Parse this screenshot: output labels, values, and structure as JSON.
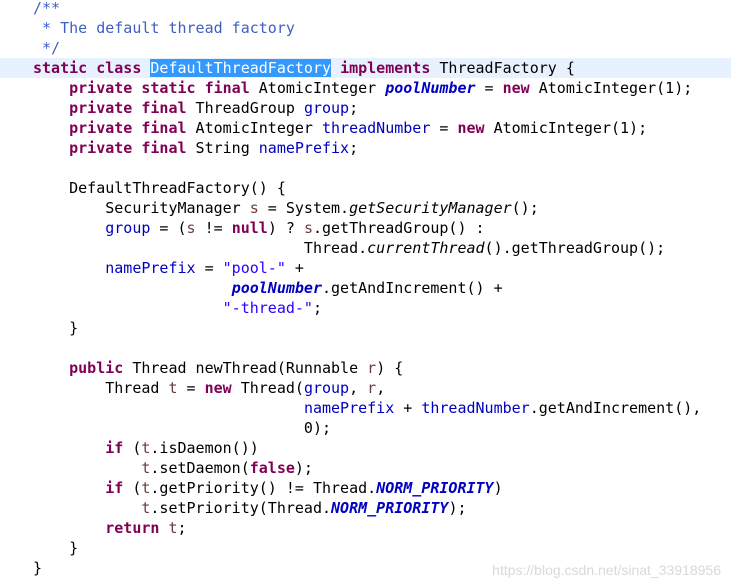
{
  "editor": {
    "language": "java",
    "current_line_highlight": "#e8f2fe",
    "selection_color": "#3399ff",
    "colors": {
      "keyword": "#7f0055",
      "field": "#0000c0",
      "string": "#2a00ff",
      "comment": "#3f5fbf",
      "local_variable": "#6a3e3e"
    },
    "lines": [
      [
        [
          "cmt",
          "/**"
        ]
      ],
      [
        [
          "cmt",
          " * The default thread factory"
        ]
      ],
      [
        [
          "cmt",
          " */"
        ]
      ],
      [
        [
          "kw",
          "static"
        ],
        [
          "plain",
          " "
        ],
        [
          "kw",
          "class"
        ],
        [
          "plain",
          " "
        ],
        [
          "sel",
          "DefaultThreadFactory"
        ],
        [
          "plain",
          " "
        ],
        [
          "kw",
          "implements"
        ],
        [
          "plain",
          " ThreadFactory {"
        ]
      ],
      [
        [
          "plain",
          "    "
        ],
        [
          "kw",
          "private"
        ],
        [
          "plain",
          " "
        ],
        [
          "kw",
          "static"
        ],
        [
          "plain",
          " "
        ],
        [
          "kw",
          "final"
        ],
        [
          "plain",
          " AtomicInteger "
        ],
        [
          "sfield",
          "poolNumber"
        ],
        [
          "plain",
          " = "
        ],
        [
          "kw",
          "new"
        ],
        [
          "plain",
          " AtomicInteger(1);"
        ]
      ],
      [
        [
          "plain",
          "    "
        ],
        [
          "kw",
          "private"
        ],
        [
          "plain",
          " "
        ],
        [
          "kw",
          "final"
        ],
        [
          "plain",
          " ThreadGroup "
        ],
        [
          "field",
          "group"
        ],
        [
          "plain",
          ";"
        ]
      ],
      [
        [
          "plain",
          "    "
        ],
        [
          "kw",
          "private"
        ],
        [
          "plain",
          " "
        ],
        [
          "kw",
          "final"
        ],
        [
          "plain",
          " AtomicInteger "
        ],
        [
          "field",
          "threadNumber"
        ],
        [
          "plain",
          " = "
        ],
        [
          "kw",
          "new"
        ],
        [
          "plain",
          " AtomicInteger(1);"
        ]
      ],
      [
        [
          "plain",
          "    "
        ],
        [
          "kw",
          "private"
        ],
        [
          "plain",
          " "
        ],
        [
          "kw",
          "final"
        ],
        [
          "plain",
          " String "
        ],
        [
          "field",
          "namePrefix"
        ],
        [
          "plain",
          ";"
        ]
      ],
      [],
      [
        [
          "plain",
          "    DefaultThreadFactory() {"
        ]
      ],
      [
        [
          "plain",
          "        SecurityManager "
        ],
        [
          "local",
          "s"
        ],
        [
          "plain",
          " = System."
        ],
        [
          "static",
          "getSecurityManager"
        ],
        [
          "plain",
          "();"
        ]
      ],
      [
        [
          "plain",
          "        "
        ],
        [
          "field",
          "group"
        ],
        [
          "plain",
          " = ("
        ],
        [
          "local",
          "s"
        ],
        [
          "plain",
          " != "
        ],
        [
          "kw",
          "null"
        ],
        [
          "plain",
          ") ? "
        ],
        [
          "local",
          "s"
        ],
        [
          "plain",
          ".getThreadGroup() :"
        ]
      ],
      [
        [
          "plain",
          "                              Thread."
        ],
        [
          "static",
          "currentThread"
        ],
        [
          "plain",
          "().getThreadGroup();"
        ]
      ],
      [
        [
          "plain",
          "        "
        ],
        [
          "field",
          "namePrefix"
        ],
        [
          "plain",
          " = "
        ],
        [
          "str",
          "\"pool-\""
        ],
        [
          "plain",
          " +"
        ]
      ],
      [
        [
          "plain",
          "                      "
        ],
        [
          "sfield",
          "poolNumber"
        ],
        [
          "plain",
          ".getAndIncrement() +"
        ]
      ],
      [
        [
          "plain",
          "                     "
        ],
        [
          "str",
          "\"-thread-\""
        ],
        [
          "plain",
          ";"
        ]
      ],
      [
        [
          "plain",
          "    }"
        ]
      ],
      [],
      [
        [
          "plain",
          "    "
        ],
        [
          "kw",
          "public"
        ],
        [
          "plain",
          " Thread newThread(Runnable "
        ],
        [
          "local",
          "r"
        ],
        [
          "plain",
          ") {"
        ]
      ],
      [
        [
          "plain",
          "        Thread "
        ],
        [
          "local",
          "t"
        ],
        [
          "plain",
          " = "
        ],
        [
          "kw",
          "new"
        ],
        [
          "plain",
          " Thread("
        ],
        [
          "field",
          "group"
        ],
        [
          "plain",
          ", "
        ],
        [
          "local",
          "r"
        ],
        [
          "plain",
          ","
        ]
      ],
      [
        [
          "plain",
          "                              "
        ],
        [
          "field",
          "namePrefix"
        ],
        [
          "plain",
          " + "
        ],
        [
          "field",
          "threadNumber"
        ],
        [
          "plain",
          ".getAndIncrement(),"
        ]
      ],
      [
        [
          "plain",
          "                              0);"
        ]
      ],
      [
        [
          "plain",
          "        "
        ],
        [
          "kw",
          "if"
        ],
        [
          "plain",
          " ("
        ],
        [
          "local",
          "t"
        ],
        [
          "plain",
          ".isDaemon())"
        ]
      ],
      [
        [
          "plain",
          "            "
        ],
        [
          "local",
          "t"
        ],
        [
          "plain",
          ".setDaemon("
        ],
        [
          "kw",
          "false"
        ],
        [
          "plain",
          ");"
        ]
      ],
      [
        [
          "plain",
          "        "
        ],
        [
          "kw",
          "if"
        ],
        [
          "plain",
          " ("
        ],
        [
          "local",
          "t"
        ],
        [
          "plain",
          ".getPriority() != Thread."
        ],
        [
          "const",
          "NORM_PRIORITY"
        ],
        [
          "plain",
          ")"
        ]
      ],
      [
        [
          "plain",
          "            "
        ],
        [
          "local",
          "t"
        ],
        [
          "plain",
          ".setPriority(Thread."
        ],
        [
          "const",
          "NORM_PRIORITY"
        ],
        [
          "plain",
          ");"
        ]
      ],
      [
        [
          "plain",
          "        "
        ],
        [
          "kw",
          "return"
        ],
        [
          "plain",
          " "
        ],
        [
          "local",
          "t"
        ],
        [
          "plain",
          ";"
        ]
      ],
      [
        [
          "plain",
          "    }"
        ]
      ],
      [
        [
          "plain",
          "}"
        ]
      ]
    ],
    "current_line_index": 3
  },
  "watermark": {
    "text": "https://blog.csdn.net/sinat_33918956"
  }
}
